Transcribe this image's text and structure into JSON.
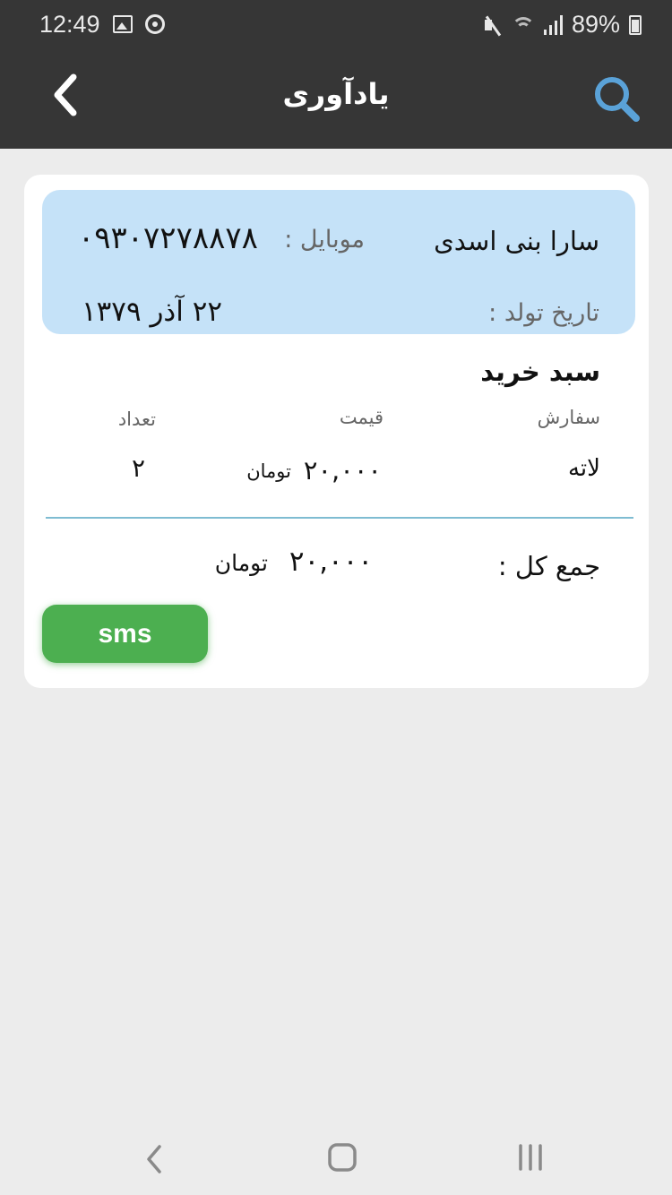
{
  "status_bar": {
    "time": "12:49",
    "battery": "89%",
    "icons": [
      "image-icon",
      "sync-icon",
      "mute-icon",
      "wifi-icon",
      "signal-icon",
      "battery-icon"
    ]
  },
  "header": {
    "title": "یادآوری",
    "back_icon": "chevron-left-icon",
    "search_icon": "search-icon",
    "background_color": "#363636",
    "search_icon_color": "#5aa2d8"
  },
  "customer": {
    "name": "سارا بنی اسدی",
    "mobile_label": "موبایل :",
    "mobile": "۰۹۳۰۷۲۷۸۸۷۸",
    "birth_label": "تاریخ تولد :",
    "birth_date": "۲۲ آذر ۱۳۷۹",
    "card_color": "#c5e2f8"
  },
  "cart": {
    "title": "سبد خرید",
    "columns": {
      "order": "سفارش",
      "price": "قیمت",
      "quantity": "تعداد"
    },
    "items": [
      {
        "name": "لاته",
        "price": "۲۰,۰۰۰",
        "unit": "تومان",
        "quantity": "۲"
      }
    ],
    "total_label": "جمع کل :",
    "total": "۲۰,۰۰۰",
    "total_unit": "تومان"
  },
  "actions": {
    "sms_label": "sms",
    "sms_color": "#4caf50"
  },
  "system_nav": {
    "icons": [
      "back-icon",
      "home-icon",
      "recents-icon"
    ]
  }
}
